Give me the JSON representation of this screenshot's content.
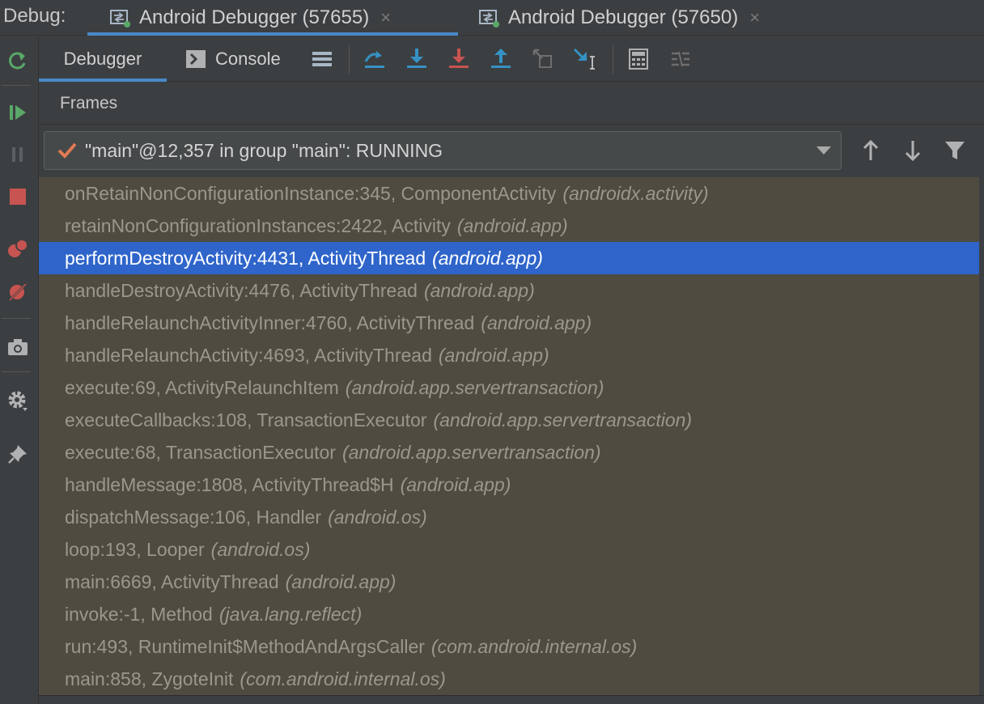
{
  "header": {
    "debug_label": "Debug:",
    "sessions": [
      {
        "label": "Android Debugger (57655)",
        "close": "×"
      },
      {
        "label": "Android Debugger (57650)",
        "close": "×"
      }
    ]
  },
  "toolbar": {
    "tabs": [
      {
        "label": "Debugger"
      },
      {
        "label": "Console"
      }
    ],
    "icons": [
      "layout-icon",
      "step-over-icon",
      "step-into-icon",
      "force-step-into-icon",
      "step-out-icon",
      "drop-frame-icon",
      "run-to-cursor-icon",
      "evaluate-expression-icon",
      "trace-current-stream-icon"
    ]
  },
  "left_toolbar": {
    "icons": [
      "rerun-icon",
      "resume-icon",
      "pause-icon",
      "stop-icon",
      "view-breakpoints-icon",
      "mute-breakpoints-icon",
      "camera-icon",
      "settings-icon",
      "pin-icon"
    ]
  },
  "frames": {
    "title": "Frames",
    "thread": "\"main\"@12,357 in group \"main\": RUNNING",
    "items": [
      {
        "method": "onRetainNonConfigurationInstance:345, ComponentActivity",
        "pkg": "(androidx.activity)"
      },
      {
        "method": "retainNonConfigurationInstances:2422, Activity",
        "pkg": "(android.app)"
      },
      {
        "method": "performDestroyActivity:4431, ActivityThread",
        "pkg": "(android.app)"
      },
      {
        "method": "handleDestroyActivity:4476, ActivityThread",
        "pkg": "(android.app)"
      },
      {
        "method": "handleRelaunchActivityInner:4760, ActivityThread",
        "pkg": "(android.app)"
      },
      {
        "method": "handleRelaunchActivity:4693, ActivityThread",
        "pkg": "(android.app)"
      },
      {
        "method": "execute:69, ActivityRelaunchItem",
        "pkg": "(android.app.servertransaction)"
      },
      {
        "method": "executeCallbacks:108, TransactionExecutor",
        "pkg": "(android.app.servertransaction)"
      },
      {
        "method": "execute:68, TransactionExecutor",
        "pkg": "(android.app.servertransaction)"
      },
      {
        "method": "handleMessage:1808, ActivityThread$H",
        "pkg": "(android.app)"
      },
      {
        "method": "dispatchMessage:106, Handler",
        "pkg": "(android.os)"
      },
      {
        "method": "loop:193, Looper",
        "pkg": "(android.os)"
      },
      {
        "method": "main:6669, ActivityThread",
        "pkg": "(android.app)"
      },
      {
        "method": "invoke:-1, Method",
        "pkg": "(java.lang.reflect)"
      },
      {
        "method": "run:493, RuntimeInit$MethodAndArgsCaller",
        "pkg": "(com.android.internal.os)"
      },
      {
        "method": "main:858, ZygoteInit",
        "pkg": "(com.android.internal.os)"
      }
    ]
  },
  "colors": {
    "selected_row": "#2f65ca",
    "frames_bg": "#4f4b41",
    "accent": "#4a88c7"
  }
}
